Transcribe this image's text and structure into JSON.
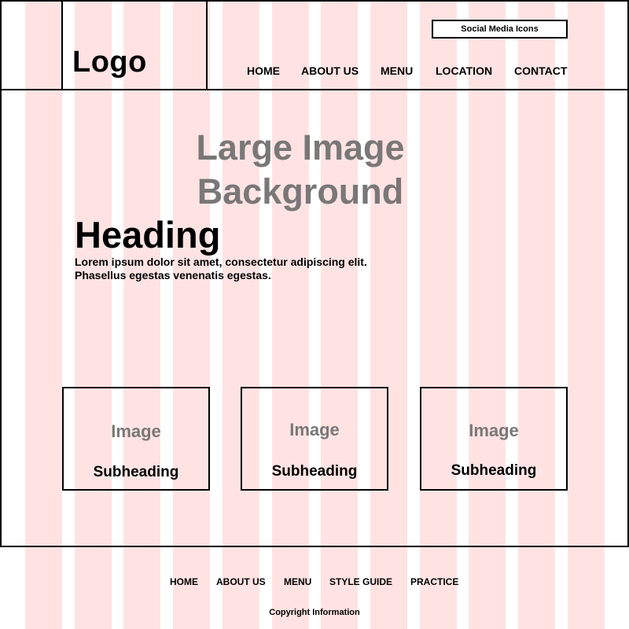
{
  "colors": {
    "grid_column": "#ffe3e3",
    "placeholder_text": "#7a7777",
    "border": "#000000"
  },
  "header": {
    "logo": "Logo",
    "social_media": "Social Media Icons",
    "nav": [
      "HOME",
      "ABOUT US",
      "MENU",
      "LOCATION",
      "CONTACT"
    ]
  },
  "hero": {
    "background_label_line1": "Large Image",
    "background_label_line2": "Background",
    "heading": "Heading",
    "body_line1": "Lorem ipsum dolor sit amet, consectetur adipiscing elit.",
    "body_line2": "Phasellus egestas venenatis egestas."
  },
  "cards": [
    {
      "image_label": "Image",
      "subheading": "Subheading"
    },
    {
      "image_label": "Image",
      "subheading": "Subheading"
    },
    {
      "image_label": "Image",
      "subheading": "Subheading"
    }
  ],
  "footer": {
    "nav": [
      "HOME",
      "ABOUT US",
      "MENU",
      "STYLE GUIDE",
      "PRACTICE"
    ],
    "copyright": "Copyright Information"
  }
}
